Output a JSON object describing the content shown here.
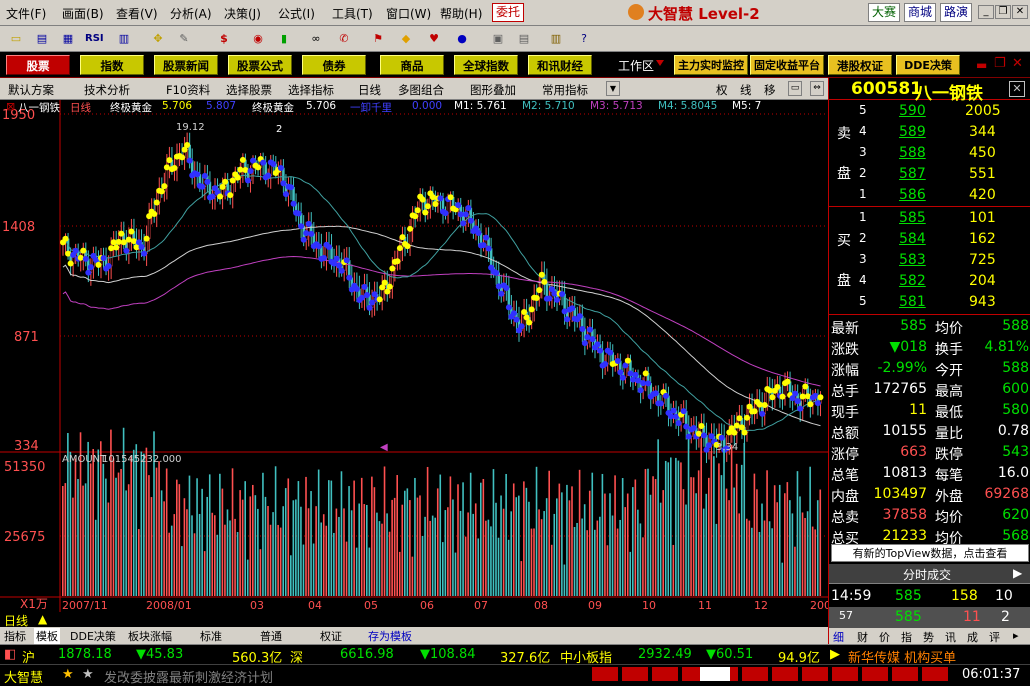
{
  "menu": [
    "文件(F)",
    "画面(B)",
    "查看(V)",
    "分析(A)",
    "决策(J)",
    "公式(I)",
    "工具(T)",
    "窗口(W)",
    "帮助(H)"
  ],
  "entrust_label": "委托",
  "brand": "大智慧 Level-2",
  "top_right": [
    "大赛",
    "商城",
    "路演"
  ],
  "nav": [
    "股票",
    "指数",
    "股票新闻",
    "股票公式",
    "债券",
    "商品",
    "全球指数",
    "和讯财经"
  ],
  "workspace": "工作区",
  "nav_right": [
    "主力实时监控",
    "固定收益平台",
    "港股权证",
    "DDE决策"
  ],
  "subbar": [
    "默认方案",
    "技术分析",
    "F10资料",
    "选择股票",
    "选择指标",
    "日线",
    "多图组合",
    "图形叠加",
    "常用指标"
  ],
  "sub_right": [
    "权",
    "线",
    "移"
  ],
  "legend": {
    "name": "八一钢铁",
    "period": "日线",
    "indicator": "终极黄金",
    "val1": "5.706",
    "val2": "5.807",
    "label2": "终极黄金",
    "val3": "5.706",
    "label3": "一卸千里",
    "val4": "0.000",
    "m1": "M1: 5.761",
    "m2": "M2: 5.710",
    "m3": "M3: 5.713",
    "m4": "M4: 5.8045",
    "m5": "M5: 7"
  },
  "chart_data": {
    "type": "line",
    "title": "八一钢铁 日线",
    "y_ticks": [
      "1950",
      "1408",
      "871",
      "334"
    ],
    "ylim": [
      3.34,
      19.5
    ],
    "high_label": "19.12",
    "low_label": "3.34",
    "marker_2": "2",
    "x_ticks": [
      "2007/11",
      "2008/01",
      "03",
      "04",
      "05",
      "06",
      "07",
      "08",
      "09",
      "10",
      "11",
      "12",
      "2009/01"
    ],
    "volume_label": "AMOUNT",
    "volume_value": "101545232.000",
    "vol_ticks": [
      "51350",
      "25675"
    ],
    "vol_unit": "X1万",
    "close": [
      13,
      12.4,
      12.2,
      13.5,
      13,
      16.2,
      17.8,
      16,
      15.6,
      16.8,
      17,
      16.6,
      14,
      12.8,
      12.2,
      10.5,
      10.6,
      13,
      15.3,
      15.2,
      14.8,
      13.5,
      11,
      9,
      11.2,
      10.4,
      9.2,
      7.8,
      7.2,
      6.5,
      5.6,
      4.6,
      3.8,
      3.4,
      4.4,
      5.4,
      6.2,
      5.6,
      5.8
    ]
  },
  "stock": {
    "code": "600581",
    "name": "八一钢铁"
  },
  "sell": [
    {
      "lv": "5",
      "p": "590",
      "v": "2005"
    },
    {
      "lv": "4",
      "p": "589",
      "v": "344"
    },
    {
      "lv": "3",
      "p": "588",
      "v": "450"
    },
    {
      "lv": "2",
      "p": "587",
      "v": "551"
    },
    {
      "lv": "1",
      "p": "586",
      "v": "420"
    }
  ],
  "buy": [
    {
      "lv": "1",
      "p": "585",
      "v": "101"
    },
    {
      "lv": "2",
      "p": "584",
      "v": "162"
    },
    {
      "lv": "3",
      "p": "583",
      "v": "725"
    },
    {
      "lv": "4",
      "p": "582",
      "v": "204"
    },
    {
      "lv": "5",
      "p": "581",
      "v": "943"
    }
  ],
  "sell_side": [
    "卖",
    "盘"
  ],
  "buy_side": [
    "买",
    "盘"
  ],
  "quote": [
    [
      "最新",
      "585",
      "均价",
      "588"
    ],
    [
      "涨跌",
      "▼018",
      "换手",
      "4.81%"
    ],
    [
      "涨幅",
      "-2.99%",
      "今开",
      "588"
    ],
    [
      "总手",
      "172765",
      "最高",
      "600"
    ],
    [
      "现手",
      "11",
      "最低",
      "580"
    ],
    [
      "总额",
      "10155",
      "量比",
      "0.78"
    ],
    [
      "涨停",
      "663",
      "跌停",
      "543"
    ],
    [
      "总笔",
      "10813",
      "每笔",
      "16.0"
    ],
    [
      "内盘",
      "103497",
      "外盘",
      "69268"
    ],
    [
      "总卖",
      "37858",
      "均价",
      "620"
    ],
    [
      "总买",
      "21233",
      "均价",
      "568"
    ]
  ],
  "topview": "有新的TopView数据，点击查看",
  "tick_title": "分时成交",
  "ticks": [
    [
      "14:59",
      "585",
      "158",
      "10"
    ],
    [
      "57",
      "585",
      "11",
      "2"
    ]
  ],
  "rp_tabs": [
    "细",
    "财",
    "价",
    "指",
    "势",
    "讯",
    "成",
    "评"
  ],
  "period": "日线",
  "bottom_tabs": [
    "指标",
    "模板",
    "DDE决策",
    "板块涨幅",
    "标准",
    "普通",
    "权证",
    "存为模板"
  ],
  "status": {
    "sh": "沪",
    "sh_idx": "1878.18",
    "sh_chg": "▼45.83",
    "sh_amt": "560.3亿",
    "sz": "深",
    "sz_idx": "6616.98",
    "sz_chg": "▼108.84",
    "sz_amt": "327.6亿",
    "sme": "中小板指",
    "sme_idx": "2932.49",
    "sme_chg": "▼60.51",
    "sme_amt": "94.9亿",
    "news": "新华传媒 机构买单"
  },
  "ticker": {
    "logo": "大智慧",
    "msg": "发改委披露最新刺激经济计划",
    "time": "06:01:37"
  },
  "colors": {
    "up": "#ff5050",
    "down": "#00e000",
    "blue": "#3030ff",
    "yellow": "#ffff00",
    "cyan": "#40c0c0",
    "magenta": "#c040c0"
  }
}
